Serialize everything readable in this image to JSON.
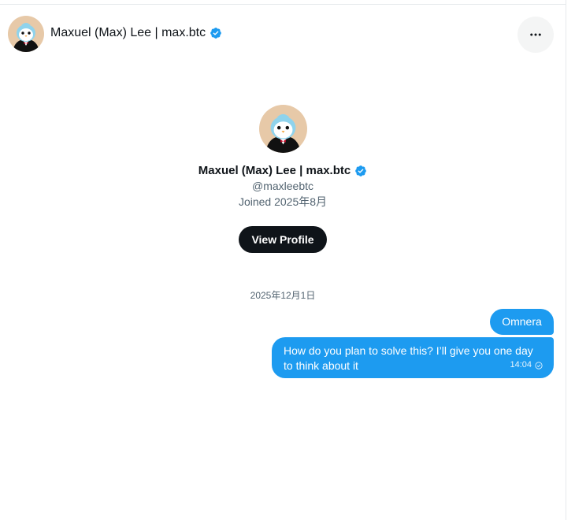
{
  "header": {
    "name": "Maxuel (Max) Lee | max.btc",
    "more_icon": "more-horizontal-icon"
  },
  "profile": {
    "name": "Maxuel (Max) Lee | max.btc",
    "handle": "@maxleebtc",
    "joined": "Joined 2025年8月",
    "view_profile_label": "View Profile"
  },
  "conversation": {
    "date_separator": "2025年12月1日",
    "messages": [
      {
        "text": "Omnera"
      },
      {
        "text": "How do you plan to solve this? I’ll give you one day to think about it",
        "time": "14:04"
      }
    ]
  },
  "colors": {
    "accent": "#1d9bf0",
    "verified": "#1d9bf0",
    "button_dark": "#0f1419",
    "secondary_text": "#536471"
  }
}
